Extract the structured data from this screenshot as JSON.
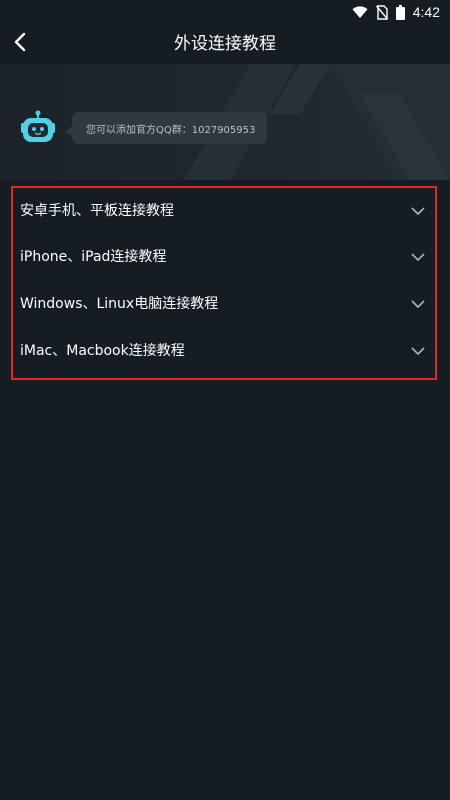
{
  "status_bar": {
    "time": "4:42",
    "icons": [
      "wifi-icon",
      "no-sim-icon",
      "battery-icon"
    ]
  },
  "header": {
    "title": "外设连接教程",
    "back_icon": "chevron-left-icon"
  },
  "banner": {
    "avatar_icon": "robot-icon",
    "message": "您可以添加官方QQ群：1027905953"
  },
  "tutorial_list": {
    "items": [
      {
        "label": "安卓手机、平板连接教程",
        "icon": "chevron-down-icon"
      },
      {
        "label": "iPhone、iPad连接教程",
        "icon": "chevron-down-icon"
      },
      {
        "label": "Windows、Linux电脑连接教程",
        "icon": "chevron-down-icon"
      },
      {
        "label": "iMac、Macbook连接教程",
        "icon": "chevron-down-icon"
      }
    ]
  },
  "colors": {
    "background": "#161d22",
    "banner": "#20282e",
    "bubble": "#2e3a40",
    "highlight_border": "#e0252b",
    "robot_accent": "#4fd2e8"
  }
}
